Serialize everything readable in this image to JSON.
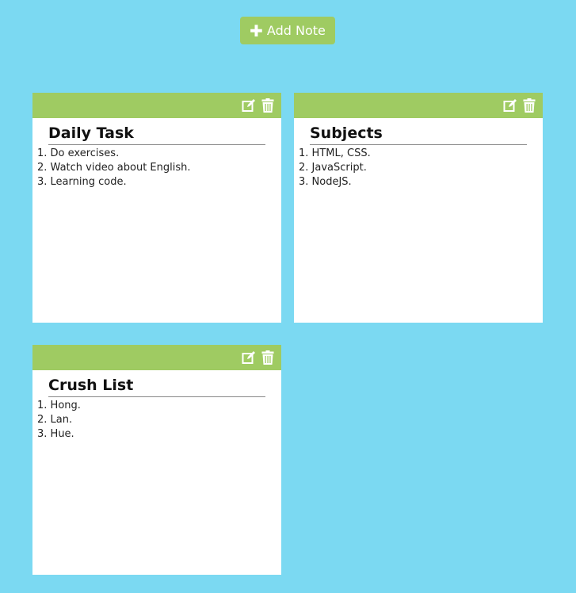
{
  "toolbar": {
    "add_note_label": "Add Note",
    "add_icon": "plus-icon"
  },
  "colors": {
    "background": "#7bd9f2",
    "accent": "#9fcb62",
    "note_bg": "#ffffff"
  },
  "notes": [
    {
      "title": "Daily Task",
      "items": [
        "Do exercises.",
        "Watch video about English.",
        "Learning code."
      ]
    },
    {
      "title": "Subjects",
      "items": [
        "HTML, CSS.",
        "JavaScript.",
        "NodeJS."
      ]
    },
    {
      "title": "Crush List",
      "items": [
        "Hong.",
        "Lan.",
        "Hue."
      ]
    }
  ]
}
